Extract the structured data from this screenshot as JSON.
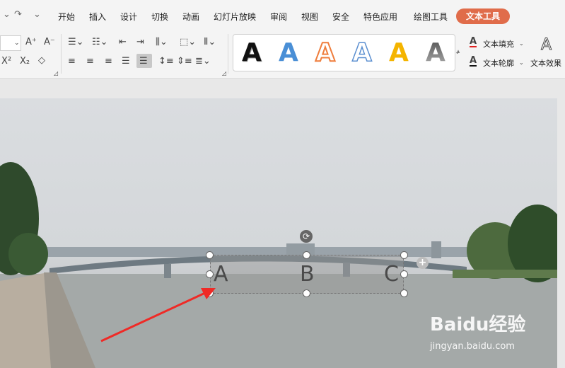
{
  "quick_access": {
    "redo_icon": "redo-icon",
    "more_icon": "dropdown-icon"
  },
  "menu": {
    "items": [
      "开始",
      "插入",
      "设计",
      "切换",
      "动画",
      "幻灯片放映",
      "审阅",
      "视图",
      "安全",
      "特色应用",
      "绘图工具"
    ],
    "active_tab": "文本工具"
  },
  "ribbon": {
    "font_grow": "A⁺",
    "font_shrink": "A⁻",
    "superscript": "X²",
    "subscript": "X₂",
    "gallery_letters": [
      "A",
      "A",
      "A",
      "A",
      "A",
      "A"
    ],
    "text_fill_label": "文本填充",
    "text_outline_label": "文本轮廓",
    "text_effects_label": "文本效果"
  },
  "slide": {
    "letters": [
      "A",
      "B",
      "C"
    ],
    "watermark": "Baidu经验",
    "watermark_sub": "jingyan.baidu.com"
  },
  "colors": {
    "accent_tab": "#e06c4a",
    "arrow": "#ef2a26",
    "text_fill_underline": "#e02020"
  }
}
